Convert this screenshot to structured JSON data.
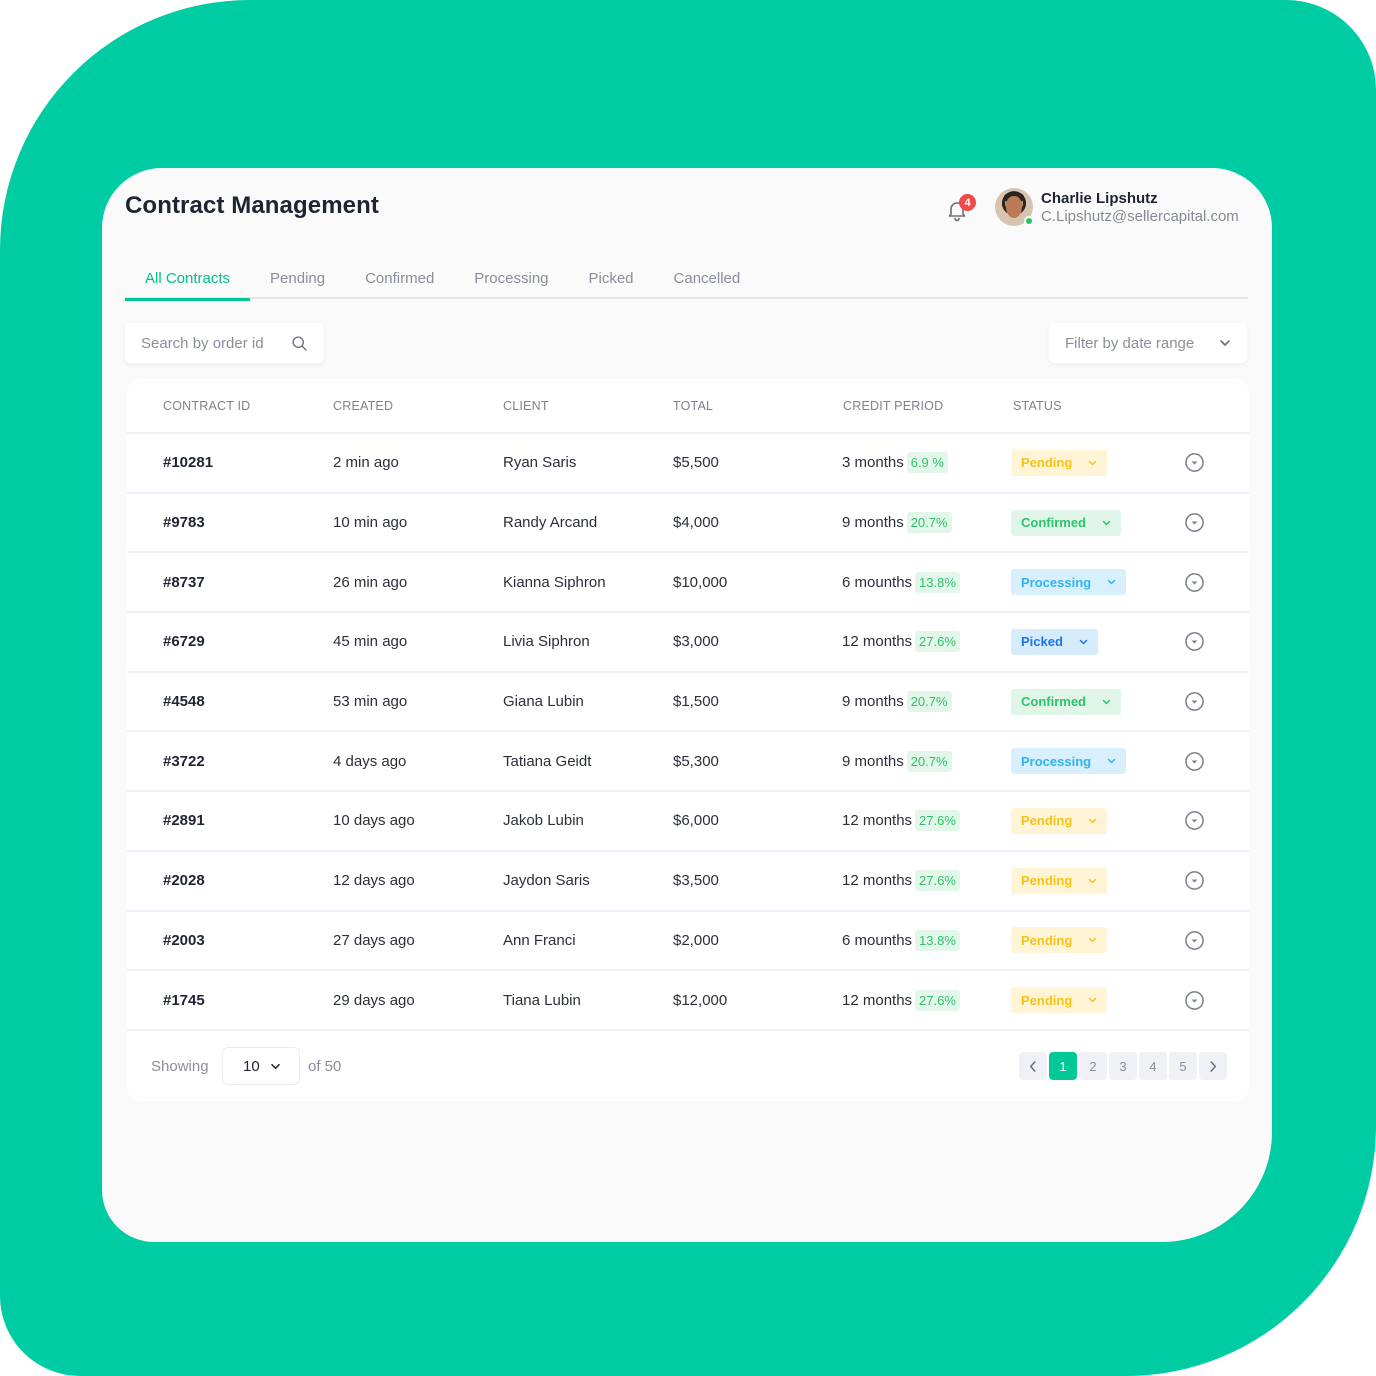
{
  "colors": {
    "brand": "#00cca3",
    "accent": "#00c896",
    "notification": "#ee4b4b",
    "status_pending": "#f6c21a",
    "status_confirmed": "#2ec36d",
    "status_processing": "#2eb4f0",
    "status_picked": "#1e73e8"
  },
  "header": {
    "title": "Contract Management",
    "notifications": {
      "icon": "bell-icon",
      "count": "4"
    },
    "user": {
      "name": "Charlie Lipshutz",
      "email": "C.Lipshutz@sellercapital.com",
      "online": true
    }
  },
  "tabs": [
    {
      "label": "All Contracts",
      "active": true
    },
    {
      "label": "Pending",
      "active": false
    },
    {
      "label": "Confirmed",
      "active": false
    },
    {
      "label": "Processing",
      "active": false
    },
    {
      "label": "Picked",
      "active": false
    },
    {
      "label": "Cancelled",
      "active": false
    }
  ],
  "search": {
    "placeholder": "Search by order id",
    "value": "",
    "icon": "search-icon"
  },
  "filter": {
    "label": "Filter by date range",
    "icon": "chevron-down-icon"
  },
  "table": {
    "columns": [
      "CONTRACT ID",
      "CREATED",
      "CLIENT",
      "TOTAL",
      "CREDIT PERIOD",
      "STATUS"
    ],
    "rows": [
      {
        "id": "#10281",
        "created": "2 min ago",
        "client": "Ryan Saris",
        "total": "$5,500",
        "period": "3 months",
        "rate": "6.9 %",
        "status": "Pending",
        "status_type": "pending"
      },
      {
        "id": "#9783",
        "created": "10 min ago",
        "client": "Randy Arcand",
        "total": "$4,000",
        "period": "9 months",
        "rate": "20.7%",
        "status": "Confirmed",
        "status_type": "confirmed"
      },
      {
        "id": "#8737",
        "created": "26 min ago",
        "client": "Kianna Siphron",
        "total": "$10,000",
        "period": "6 mounths",
        "rate": "13.8%",
        "status": "Processing",
        "status_type": "processing"
      },
      {
        "id": "#6729",
        "created": "45 min ago",
        "client": "Livia Siphron",
        "total": "$3,000",
        "period": "12 months",
        "rate": "27.6%",
        "status": "Picked",
        "status_type": "picked"
      },
      {
        "id": "#4548",
        "created": "53 min ago",
        "client": "Giana Lubin",
        "total": "$1,500",
        "period": "9 months",
        "rate": "20.7%",
        "status": "Confirmed",
        "status_type": "confirmed"
      },
      {
        "id": "#3722",
        "created": "4 days ago",
        "client": "Tatiana Geidt",
        "total": "$5,300",
        "period": "9 months",
        "rate": "20.7%",
        "status": "Processing",
        "status_type": "processing"
      },
      {
        "id": "#2891",
        "created": "10 days ago",
        "client": "Jakob Lubin",
        "total": "$6,000",
        "period": "12 months",
        "rate": "27.6%",
        "status": "Pending",
        "status_type": "pending"
      },
      {
        "id": "#2028",
        "created": "12 days ago",
        "client": "Jaydon Saris",
        "total": "$3,500",
        "period": "12 months",
        "rate": "27.6%",
        "status": "Pending",
        "status_type": "pending"
      },
      {
        "id": "#2003",
        "created": "27 days ago",
        "client": "Ann Franci",
        "total": "$2,000",
        "period": "6 mounths",
        "rate": "13.8%",
        "status": "Pending",
        "status_type": "pending"
      },
      {
        "id": "#1745",
        "created": "29 days ago",
        "client": "Tiana Lubin",
        "total": "$12,000",
        "period": "12 months",
        "rate": "27.6%",
        "status": "Pending",
        "status_type": "pending"
      }
    ]
  },
  "footer": {
    "showing_label": "Showing",
    "page_size": "10",
    "of_total": "of 50",
    "pages": [
      "1",
      "2",
      "3",
      "4",
      "5"
    ],
    "current_page": "1"
  }
}
